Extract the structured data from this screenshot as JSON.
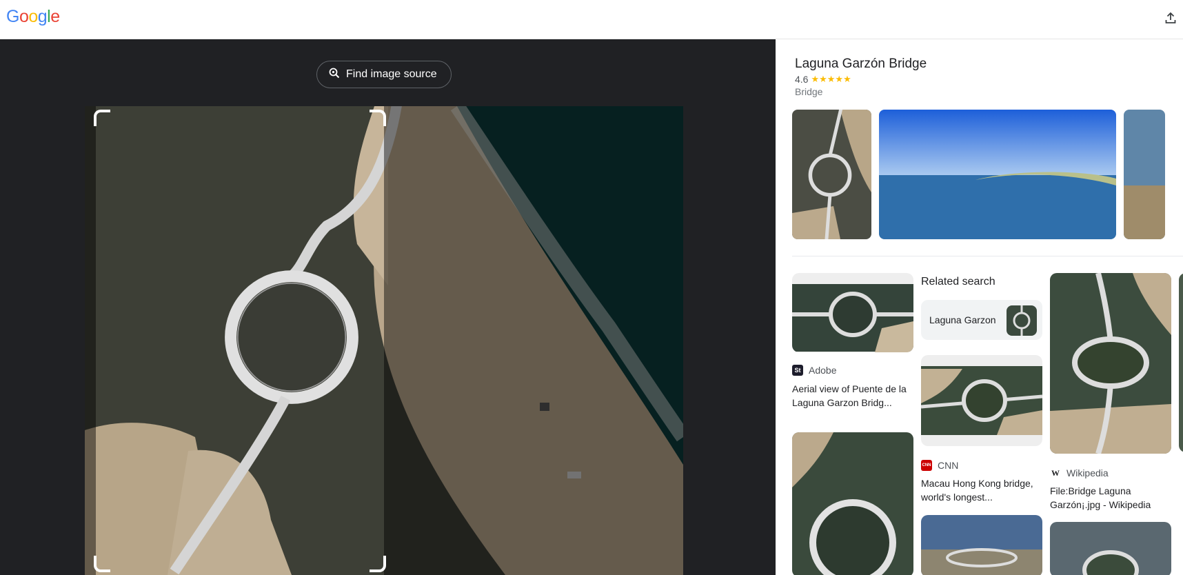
{
  "header": {
    "logo_letters": [
      "G",
      "o",
      "o",
      "g",
      "l",
      "e"
    ],
    "logo_colors": [
      "#4285F4",
      "#EA4335",
      "#FBBC05",
      "#4285F4",
      "#34A853",
      "#EA4335"
    ],
    "share_icon": "upload-share-icon"
  },
  "lens": {
    "find_source_label": "Find image source",
    "find_source_icon": "lens-search-icon"
  },
  "knowledge_panel": {
    "title": "Laguna Garzón Bridge",
    "rating": "4.6",
    "stars": "★★★★★",
    "type": "Bridge"
  },
  "results": [
    {
      "source": "Adobe",
      "source_logo": "St",
      "logo_color": "#1d1d2c",
      "caption": "Aerial view of Puente de la Laguna Garzon Bridg..."
    },
    {
      "source": "CNN",
      "source_logo": "CNN",
      "logo_color": "#cc0000",
      "caption": "Macau Hong Kong bridge, world's longest..."
    },
    {
      "source": "Wikipedia",
      "source_logo": "W",
      "logo_color": "#ffffff",
      "caption": "File:Bridge Laguna Garzón¡.jpg - Wikipedia"
    }
  ],
  "related": {
    "title": "Related search",
    "chip_label": "Laguna Garzon"
  }
}
